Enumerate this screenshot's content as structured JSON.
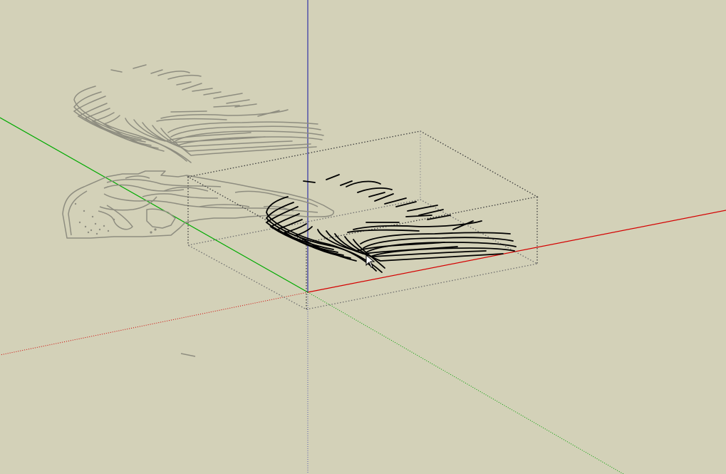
{
  "app": {
    "view": "3d-modeling-viewport",
    "background_color": "#d3d1b8"
  },
  "axes": {
    "red_axis": {
      "name": "red-axis",
      "color": "#d40000"
    },
    "green_axis": {
      "name": "green-axis",
      "color": "#00aa00"
    },
    "blue_axis": {
      "name": "blue-axis",
      "color": "#3232a8"
    }
  },
  "model": {
    "selected_contours_color": "#000000",
    "inactive_contours_color": "#8e8d80",
    "selection_box_color": "#3c3c3c",
    "cursor": "select-arrow-icon"
  }
}
